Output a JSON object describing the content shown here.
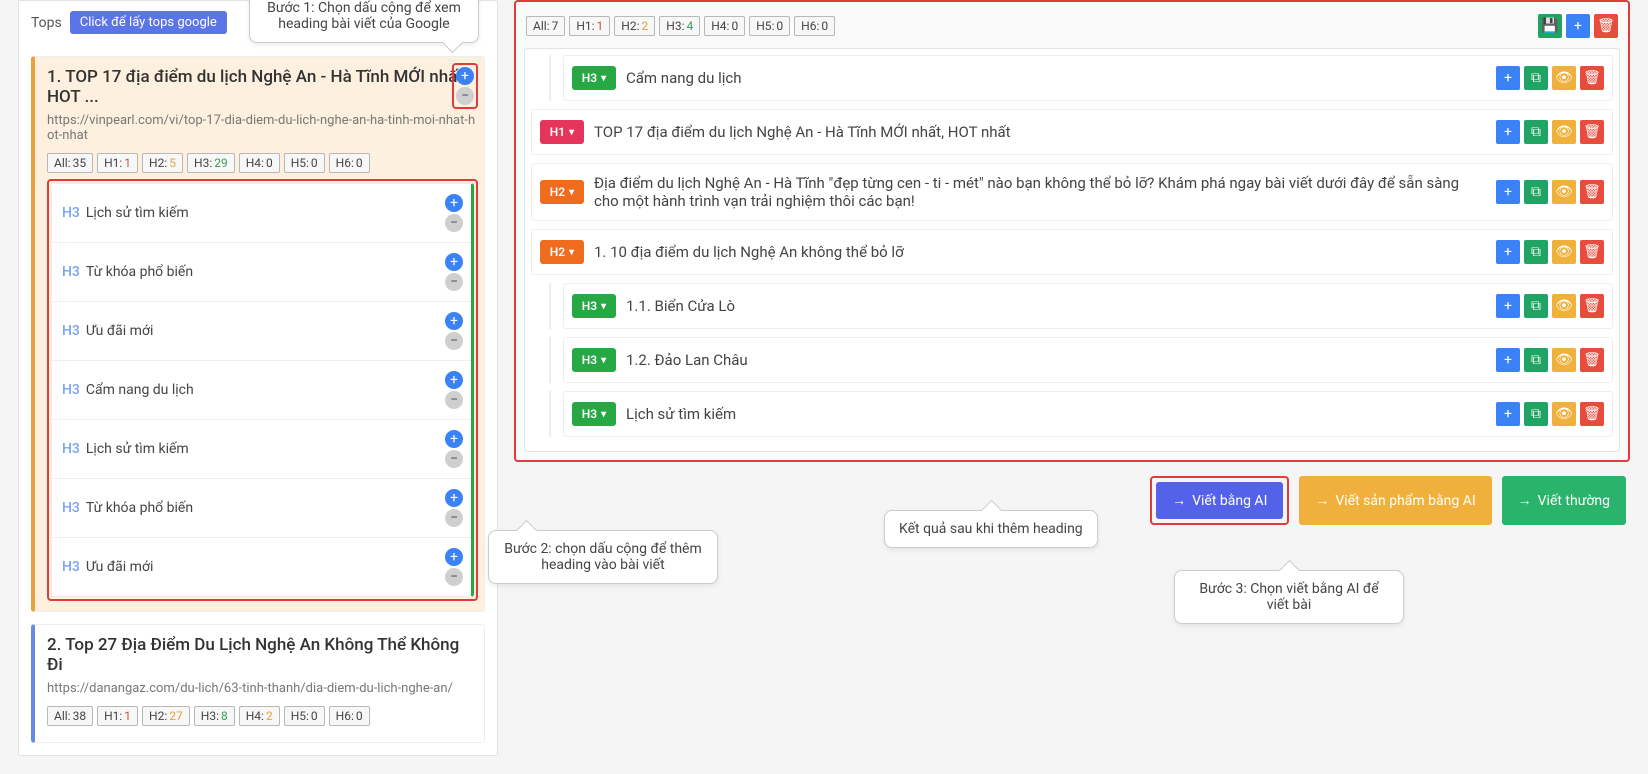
{
  "tops": {
    "label": "Tops",
    "button": "Click để lấy tops google"
  },
  "callouts": {
    "step1": "Bước 1: Chọn dấu cộng để xem heading bài viết của Google",
    "step2": "Bước 2: chọn dấu cộng để thêm heading vào bài viết",
    "step3": "Bước 3: Chọn viết bằng AI để viết bài",
    "result": "Kết quả sau khi thêm heading"
  },
  "left": {
    "items": [
      {
        "title": "1. TOP 17 địa điểm du lịch Nghệ An - Hà Tĩnh MỚI nhất, HOT ...",
        "url": "https://vinpearl.com/vi/top-17-dia-diem-du-lich-nghe-an-ha-tinh-moi-nhat-hot-nhat",
        "highlight": true,
        "counts": {
          "all": "35",
          "h1": "1",
          "h2": "5",
          "h3": "29",
          "h4": "0",
          "h5": "0",
          "h6": "0"
        },
        "headings": [
          {
            "tag": "H3",
            "text": "Lịch sử tìm kiếm"
          },
          {
            "tag": "H3",
            "text": "Từ khóa phổ biến"
          },
          {
            "tag": "H3",
            "text": "Ưu đãi mới"
          },
          {
            "tag": "H3",
            "text": "Cẩm nang du lịch"
          },
          {
            "tag": "H3",
            "text": "Lịch sử tìm kiếm"
          },
          {
            "tag": "H3",
            "text": "Từ khóa phổ biến"
          },
          {
            "tag": "H3",
            "text": "Ưu đãi mới"
          }
        ]
      },
      {
        "title": "2. Top 27 Địa Điểm Du Lịch Nghệ An Không Thể Không Đi",
        "url": "https://danangaz.com/du-lich/63-tinh-thanh/dia-diem-du-lich-nghe-an/",
        "highlight": false,
        "counts": {
          "all": "38",
          "h1": "1",
          "h2": "27",
          "h3": "8",
          "h4": "2",
          "h5": "0",
          "h6": "0"
        }
      }
    ]
  },
  "right": {
    "counts": {
      "all": "7",
      "h1": "1",
      "h2": "2",
      "h3": "4",
      "h4": "0",
      "h5": "0",
      "h6": "0"
    },
    "outline": [
      {
        "level": "H3",
        "text": "Cẩm nang du lịch",
        "indent": 1
      },
      {
        "level": "H1",
        "text": "TOP 17 địa điểm du lịch Nghệ An - Hà Tĩnh MỚI nhất, HOT nhất",
        "indent": 0
      },
      {
        "level": "H2",
        "text": "Địa điểm du lịch Nghệ An - Hà Tĩnh \"đẹp từng cen - ti - mét\" nào bạn không thể bỏ lỡ? Khám phá ngay bài viết dưới đây để sẵn sàng cho một hành trình vạn trải nghiệm thôi các bạn!",
        "indent": 0
      },
      {
        "level": "H2",
        "text": "1. 10 địa điểm du lịch Nghệ An không thể bỏ lỡ",
        "indent": 0
      },
      {
        "level": "H3",
        "text": "1.1. Biển Cửa Lò",
        "indent": 1
      },
      {
        "level": "H3",
        "text": "1.2. Đảo Lan Châu",
        "indent": 1
      },
      {
        "level": "H3",
        "text": "Lịch sử tìm kiếm",
        "indent": 1
      }
    ],
    "buttons": {
      "ai": "Viết bằng AI",
      "product_ai": "Viết sản phẩm bằng AI",
      "normal": "Viết thường"
    }
  },
  "labels": {
    "all": "All:",
    "h1": "H1:",
    "h2": "H2:",
    "h3": "H3:",
    "h4": "H4:",
    "h5": "H5:",
    "h6": "H6:"
  }
}
